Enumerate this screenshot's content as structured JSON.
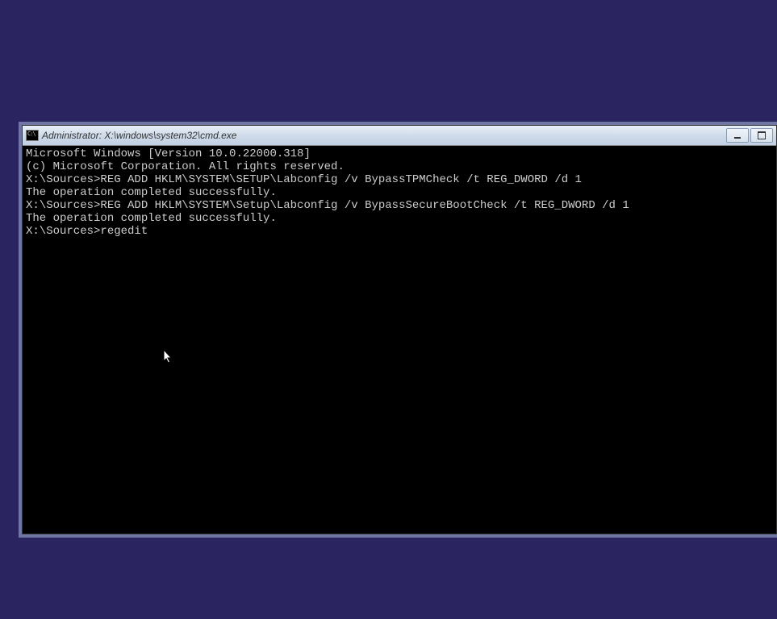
{
  "window": {
    "title": "Administrator: X:\\windows\\system32\\cmd.exe"
  },
  "terminal": {
    "line1": "Microsoft Windows [Version 10.0.22000.318]",
    "line2": "(c) Microsoft Corporation. All rights reserved.",
    "line3": "",
    "line4": "X:\\Sources>REG ADD HKLM\\SYSTEM\\SETUP\\Labconfig /v BypassTPMCheck /t REG_DWORD /d 1",
    "line5": "The operation completed successfully.",
    "line6": "",
    "line7": "X:\\Sources>REG ADD HKLM\\SYSTEM\\Setup\\Labconfig /v BypassSecureBootCheck /t REG_DWORD /d 1",
    "line8": "The operation completed successfully.",
    "line9": "",
    "line10": "X:\\Sources>regedit"
  }
}
